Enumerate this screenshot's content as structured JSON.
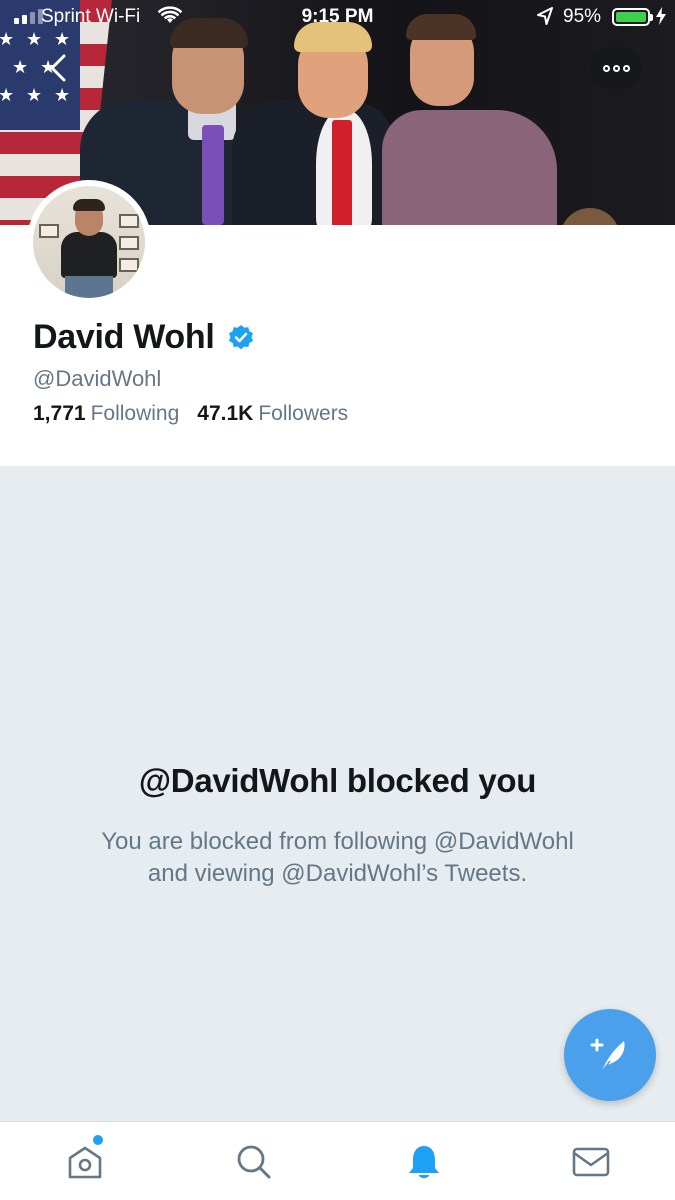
{
  "status_bar": {
    "carrier": "Sprint Wi-Fi",
    "time": "9:15 PM",
    "battery": "95%"
  },
  "profile": {
    "name": "David Wohl",
    "handle": "@DavidWohl",
    "following_count": "1,771",
    "following_label": "Following",
    "followers_count": "47.1K",
    "followers_label": "Followers",
    "verified": true
  },
  "blocked": {
    "title": "@DavidWohl blocked you",
    "line1": "You are blocked from following @DavidWohl",
    "line2": "and viewing @DavidWohl’s Tweets."
  },
  "tabs": [
    {
      "name": "home",
      "icon": "home-icon",
      "has_dot": true
    },
    {
      "name": "search",
      "icon": "search-icon"
    },
    {
      "name": "notifications",
      "icon": "bell-icon",
      "active": true
    },
    {
      "name": "messages",
      "icon": "mail-icon"
    }
  ],
  "colors": {
    "accent": "#1da1f2",
    "fab": "#4aa0eb",
    "blocked_bg": "#e6ecf0",
    "secondary_text": "#657786"
  }
}
